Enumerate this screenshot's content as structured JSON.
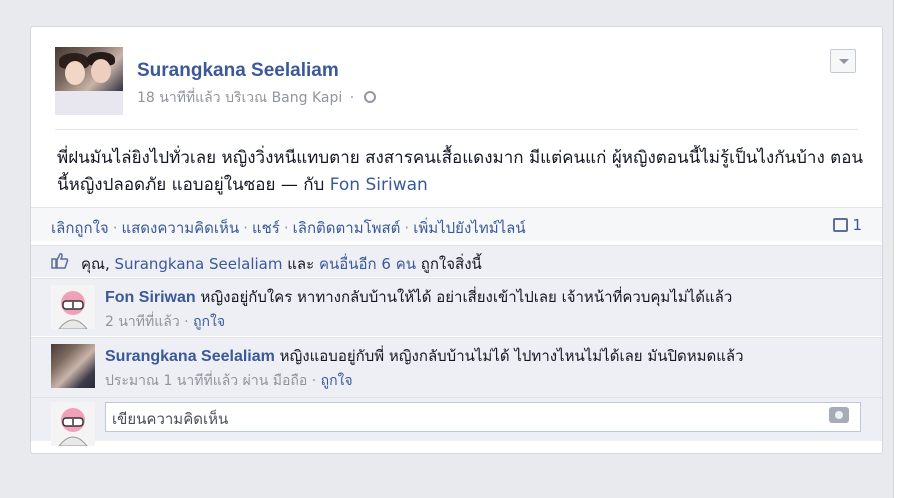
{
  "post": {
    "author": "Surangkana Seelaliam",
    "time": "18 นาทีที่แล้ว",
    "location_prefix": "บริเวณ",
    "location": "Bang Kapi",
    "text": "พี่ฝนมันไล่ยิงไปทั่วเลย หญิงวิ่งหนีแทบตาย สงสารคนเสื้อแดงมาก มีแต่คนแก่ ผู้หญิงตอนนี้ไม่รู้เป็นไงกันบ้าง ตอนนี้หญิงปลอดภัย แอบอยู่ในซอย",
    "with_prefix": "— กับ",
    "with_name": "Fon Siriwan"
  },
  "actions": {
    "unlike": "เลิกถูกใจ",
    "comment": "แสดงความคิดเห็น",
    "share": "แชร์",
    "unfollow": "เลิกติดตามโพสต์",
    "timeline": "เพิ่มไปยังไทม์ไลน์",
    "comment_count": "1"
  },
  "likes": {
    "you": "คุณ,",
    "name": "Surangkana Seelaliam",
    "and": "และ",
    "others": "คนอื่นอีก 6 คน",
    "suffix": "ถูกใจสิ่งนี้"
  },
  "comments": [
    {
      "name": "Fon Siriwan",
      "text": "หญิงอยู่กับใคร หาทางกลับบ้านให้ได้ อย่าเสี่ยงเข้าไปเลย เจ้าหน้าที่ควบคุมไม่ได้แล้ว",
      "time": "2 นาทีที่แล้ว",
      "like": "ถูกใจ"
    },
    {
      "name": "Surangkana Seelaliam",
      "text": "หญิงแอบอยู่กับพี่ หญิงกลับบ้านไม่ได้ ไปทางไหนไม่ได้เลย มันปิดหมดแล้ว",
      "time": "ประมาณ 1 นาทีที่แล้ว",
      "via": "ผ่าน มือถือ",
      "like": "ถูกใจ"
    }
  ],
  "composer": {
    "placeholder": "เขียนความคิดเห็น"
  },
  "colors": {
    "link": "#3b5998",
    "background": "#e9eaed",
    "panel": "#edeff4"
  }
}
